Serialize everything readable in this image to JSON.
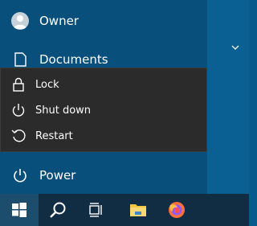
{
  "start_menu": {
    "user_name": "Owner",
    "documents_label": "Documents",
    "power_label": "Power"
  },
  "power_menu": {
    "items": [
      {
        "label": "Lock",
        "icon": "lock-icon"
      },
      {
        "label": "Shut down",
        "icon": "power-icon"
      },
      {
        "label": "Restart",
        "icon": "restart-icon"
      }
    ]
  },
  "taskbar": {
    "buttons": [
      "windows-start-icon",
      "search-icon",
      "task-view-icon",
      "file-explorer-icon",
      "firefox-icon"
    ]
  },
  "colors": {
    "start_pane": "#084f7c",
    "power_menu_bg": "#2b2b2b",
    "taskbar_bg": "#112d44"
  }
}
